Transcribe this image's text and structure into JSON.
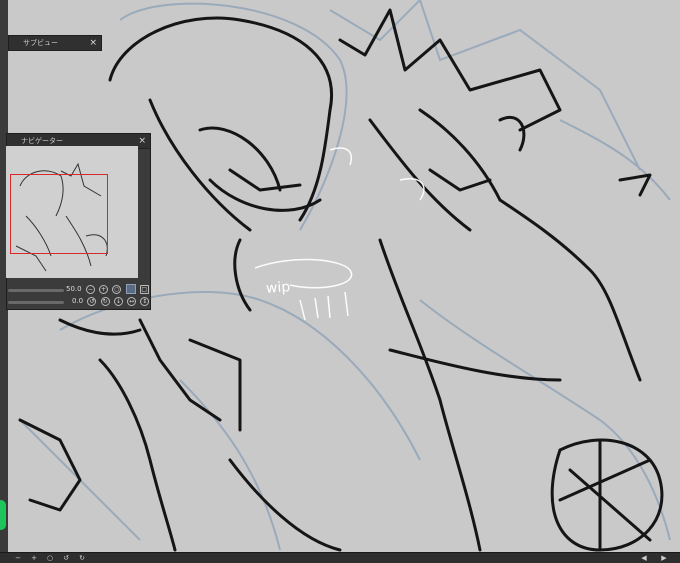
{
  "canvas": {
    "annotation_text": "wip"
  },
  "sub_view_panel": {
    "title": "サブビュー",
    "close_label": "×"
  },
  "navigator_panel": {
    "title": "ナビゲーター",
    "close_label": "×",
    "zoom_value": "50.0",
    "rotation_value": "0.0"
  },
  "colors": {
    "frame_red": "#d42a2a",
    "accent_blue": "#5a6b84",
    "status_green": "#1fc45a"
  }
}
